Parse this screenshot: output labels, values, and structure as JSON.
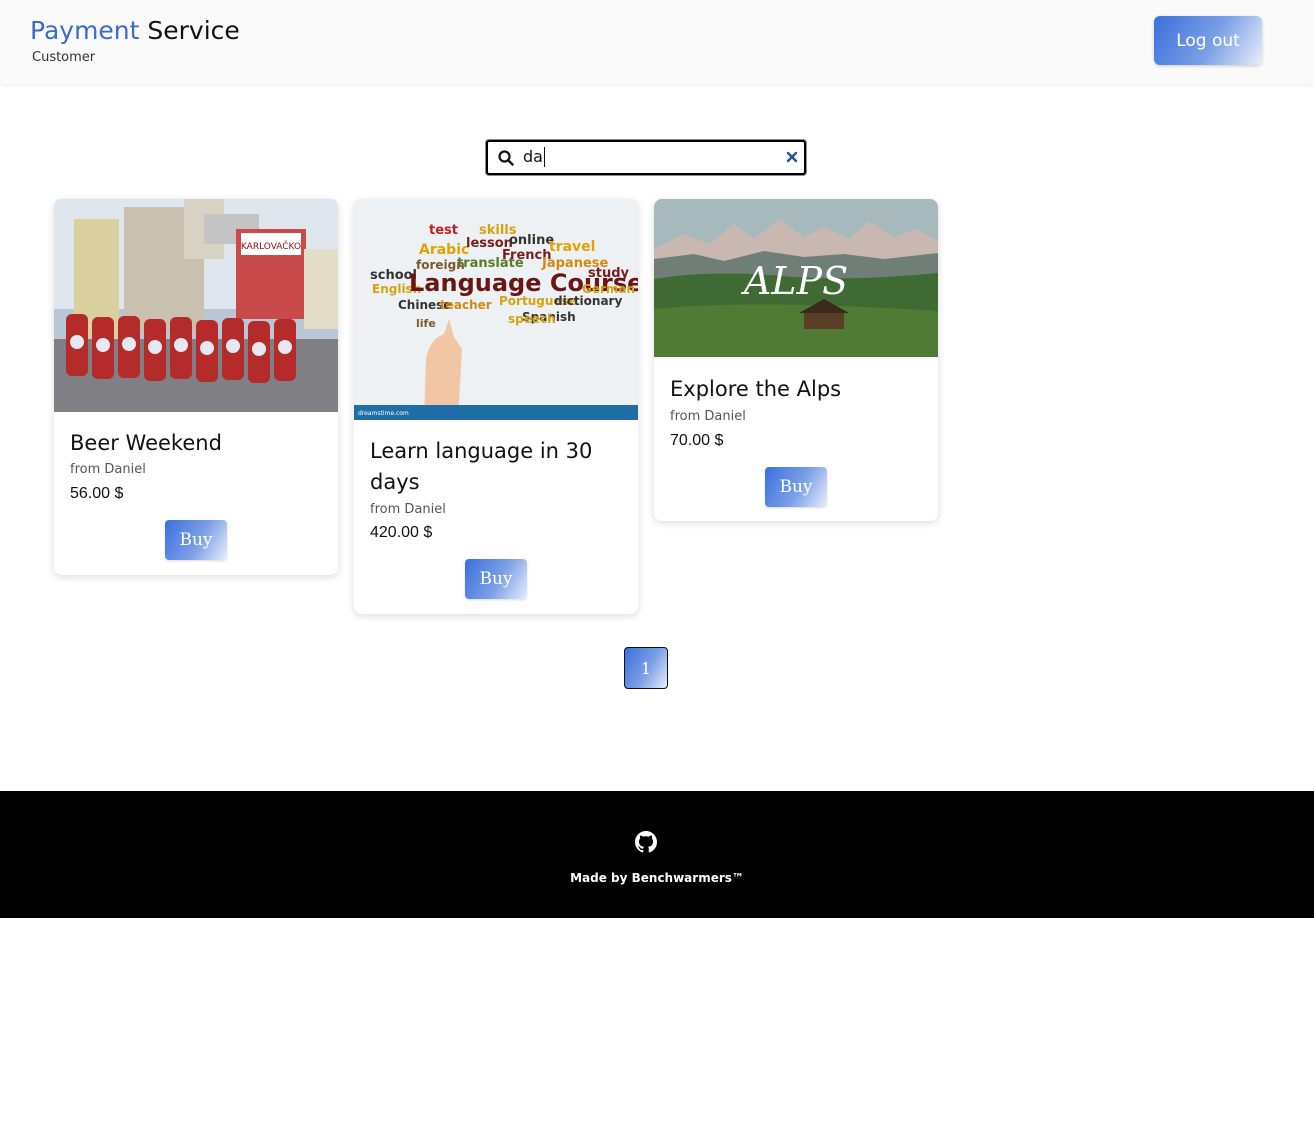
{
  "header": {
    "brand_accent": "Payment",
    "brand_rest": " Service",
    "role": "Customer",
    "logout_label": "Log out"
  },
  "search": {
    "query": "da"
  },
  "products": [
    {
      "title": "Beer Weekend",
      "seller": "from Daniel",
      "price": "56.00 $",
      "buy_label": "Buy",
      "image_text": "KARLOVAČKO"
    },
    {
      "title": "Learn language in 30 days",
      "seller": "from Daniel",
      "price": "420.00 $",
      "buy_label": "Buy",
      "image_text": "Language Courses"
    },
    {
      "title": "Explore the Alps",
      "seller": "from Daniel",
      "price": "70.00 $",
      "buy_label": "Buy",
      "image_text": "ALPS"
    }
  ],
  "pagination": {
    "current_page": "1"
  },
  "footer": {
    "credit": "Made by Benchwarmers™"
  },
  "colors": {
    "brand_accent": "#3a6cc8",
    "button_gradient_start": "#3a6fdc",
    "footer_bg": "#000000"
  }
}
